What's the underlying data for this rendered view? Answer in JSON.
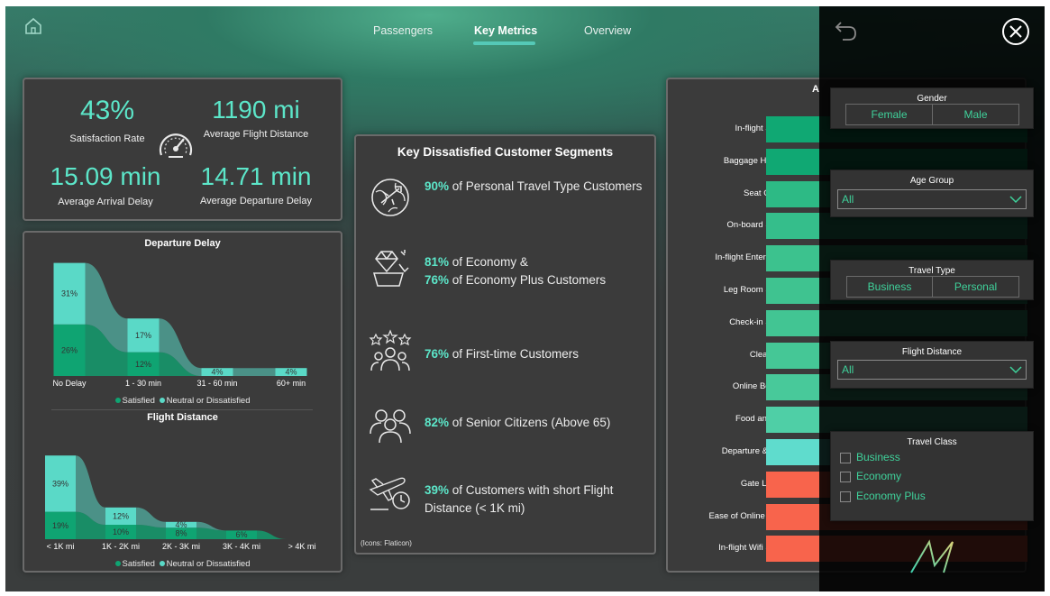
{
  "nav": {
    "home_icon": "home-icon",
    "tabs": [
      {
        "label": "Passengers",
        "active": false
      },
      {
        "label": "Key Metrics",
        "active": true
      },
      {
        "label": "Overview",
        "active": false
      }
    ],
    "accent": "#55c9b7"
  },
  "kpis": {
    "satisfaction_rate": {
      "value": "43%",
      "label": "Satisfaction Rate"
    },
    "avg_flight_distance": {
      "value": "1190 mi",
      "label": "Average Flight Distance"
    },
    "avg_arrival_delay": {
      "value": "15.09 min",
      "label": "Average Arrival Delay"
    },
    "avg_departure_delay": {
      "value": "14.71 min",
      "label": "Average Departure Delay"
    },
    "center_icon": "speedometer-icon"
  },
  "departure_delay_chart": {
    "title": "Departure Delay",
    "legend": {
      "satisfied": "Satisfied",
      "neutral": "Neutral or Dissatisfied"
    }
  },
  "flight_distance_chart": {
    "title": "Flight Distance",
    "legend": {
      "satisfied": "Satisfied",
      "neutral": "Neutral or Dissatisfied"
    }
  },
  "chart_data": [
    {
      "type": "area",
      "title": "Departure Delay",
      "categories": [
        "No Delay",
        "1 - 30 min",
        "31 - 60 min",
        "60+ min"
      ],
      "series": [
        {
          "name": "Satisfied",
          "values": [
            26,
            12,
            null,
            null
          ],
          "labels": [
            "26%",
            "12%",
            "",
            ""
          ],
          "color": "#0fa472"
        },
        {
          "name": "Neutral or Dissatisfied",
          "values": [
            31,
            17,
            4,
            4
          ],
          "labels": [
            "31%",
            "17%",
            "4%",
            "4%"
          ],
          "color": "#5ad9c7"
        }
      ]
    },
    {
      "type": "area",
      "title": "Flight Distance",
      "categories": [
        "< 1K mi",
        "1K - 2K mi",
        "2K - 3K mi",
        "3K - 4K mi",
        "> 4K mi"
      ],
      "series": [
        {
          "name": "Satisfied",
          "values": [
            19,
            10,
            8,
            6,
            null
          ],
          "labels": [
            "19%",
            "10%",
            "8%",
            "6%",
            ""
          ],
          "color": "#0fa472"
        },
        {
          "name": "Neutral or Dissatisfied",
          "values": [
            39,
            12,
            4,
            null,
            null
          ],
          "labels": [
            "39%",
            "12%",
            "4%",
            "",
            ""
          ],
          "color": "#5ad9c7"
        }
      ]
    },
    {
      "type": "bar",
      "orientation": "horizontal",
      "categories": [
        "In-flight Service",
        "Baggage Handling",
        "Seat Comfort",
        "On-board Service",
        "In-flight Entertainm...",
        "Leg Room Service",
        "Check-in Service",
        "Cleanliness",
        "Online Boarding",
        "Food and Drink",
        "Departure & Arrival",
        "Gate Location",
        "Ease of Online Book...",
        "In-flight Wifi Service"
      ],
      "bar_colors": [
        "#10a873",
        "#10a873",
        "#2dba85",
        "#35be8b",
        "#3cc28e",
        "#3fc390",
        "#42c593",
        "#45c796",
        "#48c99a",
        "#4fcfa6",
        "#5fdccd",
        "#f8644c",
        "#f8644c",
        "#f8644c"
      ]
    }
  ],
  "segments": {
    "title": "Key Dissatisfied Customer Segments",
    "credit": "(Icons: Flaticon)",
    "items": [
      {
        "icon": "globe-airplane-icon",
        "pct": "90%",
        "text": " of Personal Travel Type Customers"
      },
      {
        "icon": "diamond-basket-icon",
        "pct": "81%",
        "text": " of Economy &",
        "pct2": "76%",
        "text2": " of Economy Plus Customers"
      },
      {
        "icon": "stars-people-icon",
        "pct": "76%",
        "text": " of First-time Customers"
      },
      {
        "icon": "senior-group-icon",
        "pct": "82%",
        "text": " of Senior Citizens (Above 65)"
      },
      {
        "icon": "airplane-clock-icon",
        "pct": "39%",
        "text": " of Customers with short Flight Distance (< 1K mi)"
      }
    ]
  },
  "services_card": {
    "header_partial": "A"
  },
  "filter_pane": {
    "back_icon": "undo-icon",
    "close_icon": "close-icon",
    "gender": {
      "title": "Gender",
      "options": [
        "Female",
        "Male"
      ]
    },
    "age_group": {
      "title": "Age Group",
      "value": "All"
    },
    "travel_type": {
      "title": "Travel Type",
      "options": [
        "Business",
        "Personal"
      ]
    },
    "flight_distance": {
      "title": "Flight Distance",
      "value": "All"
    },
    "travel_class": {
      "title": "Travel Class",
      "options": [
        "Business",
        "Economy",
        "Economy Plus"
      ]
    },
    "logo_icon": "brand-logo-icon",
    "accent": "#3fd29b"
  }
}
